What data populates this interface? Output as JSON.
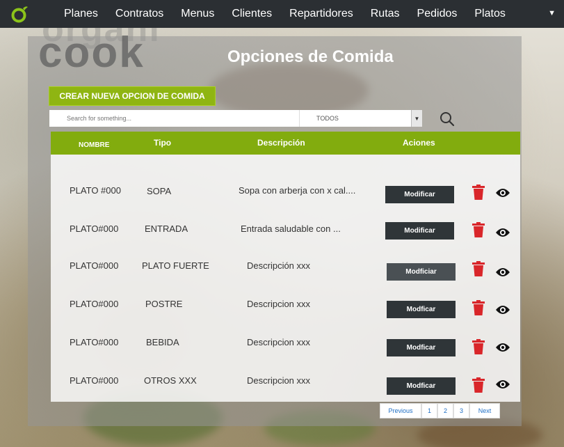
{
  "nav": {
    "items": [
      "Planes",
      "Contratos",
      "Menus",
      "Clientes",
      "Repartidores",
      "Rutas",
      "Pedidos",
      "Platos"
    ],
    "dropdown_icon": "caret-down-icon"
  },
  "brand": {
    "text": "cook",
    "faded_text": "organi"
  },
  "page": {
    "title": "Opciones de Comida"
  },
  "actions": {
    "create_label": "CREAR NUEVA OPCION DE COMIDA"
  },
  "filters": {
    "search_placeholder": "Search for something...",
    "type_selected": "TODOS"
  },
  "table": {
    "headers": {
      "name": "NOMBRE",
      "type": "Tipo",
      "description": "Descripción",
      "actions": "Aciones"
    },
    "rows": [
      {
        "name": "PLATO #000",
        "type": "SOPA",
        "description": "Sopa con arberja con x cal....",
        "modify_label": "Modificar"
      },
      {
        "name": "PLATO#000",
        "type": "ENTRADA",
        "description": "Entrada  saludable con ...",
        "modify_label": "Modificar"
      },
      {
        "name": "PLATO#000",
        "type": "PLATO FUERTE",
        "description": "Descripción xxx",
        "modify_label": "Modficiar"
      },
      {
        "name": "PLATO#000",
        "type": "POSTRE",
        "description": "Descripcion xxx",
        "modify_label": "Modficar"
      },
      {
        "name": "PLATO#000",
        "type": "BEBIDA",
        "description": "Descripcion xxx",
        "modify_label": "Modficar"
      },
      {
        "name": "PLATO#000",
        "type": "OTROS XXX",
        "description": "Descripcion xxx",
        "modify_label": "Modficar"
      }
    ]
  },
  "pagination": {
    "previous": "Previous",
    "pages": [
      "1",
      "2",
      "3"
    ],
    "next": "Next"
  },
  "colors": {
    "navbar": "#2b2f33",
    "accent_green": "#82ac0e",
    "button_dark": "#2f3538",
    "delete_red": "#d9262a",
    "link_blue": "#1f6fc5"
  }
}
